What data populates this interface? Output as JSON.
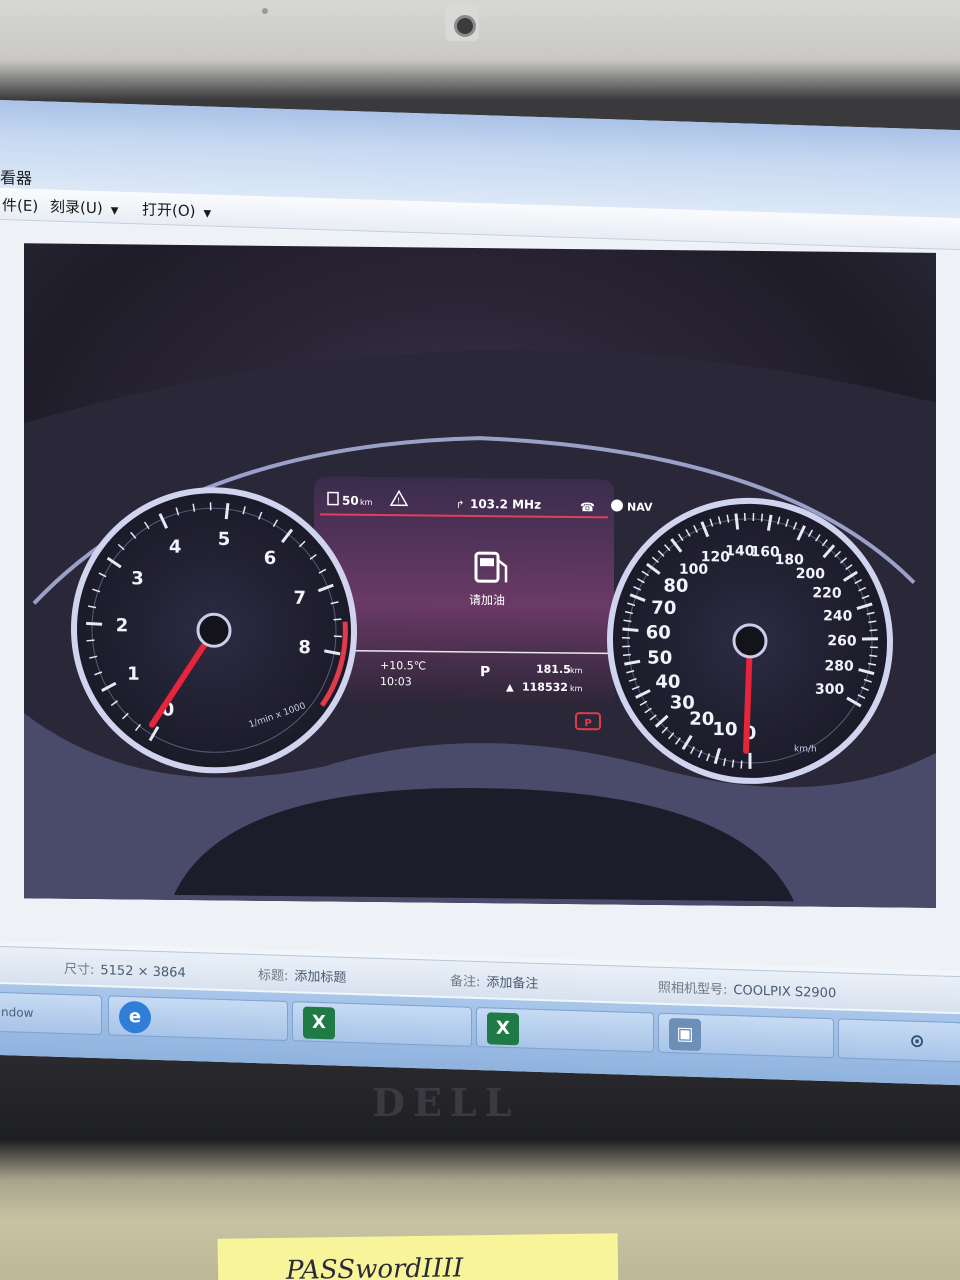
{
  "window": {
    "title": "看器",
    "menu": [
      {
        "label": "件(E)",
        "has_caret": false
      },
      {
        "label": "刻录(U)",
        "has_caret": true
      },
      {
        "label": "打开(O)",
        "has_caret": true
      }
    ]
  },
  "photo": {
    "cluster": {
      "top_bar": {
        "range": "50",
        "range_unit": "km",
        "radio": "103.2 MHz",
        "nav": "NAV"
      },
      "center_msg": "请加油",
      "bottom_info": {
        "outside_temp": "+10.5℃",
        "time": "10:03",
        "gear": "P",
        "trip": "181.5",
        "trip_unit": "km",
        "odometer": "118532",
        "odo_unit": "km"
      },
      "tacho": {
        "labels": [
          "0",
          "1",
          "2",
          "3",
          "4",
          "5",
          "6",
          "7",
          "8"
        ],
        "caption": "1/min x 1000"
      },
      "speedo": {
        "labels": [
          "0",
          "10",
          "20",
          "30",
          "40",
          "50",
          "60",
          "70",
          "80",
          "100",
          "120",
          "140",
          "160",
          "180",
          "200",
          "220",
          "240",
          "260",
          "280",
          "300"
        ],
        "unit": "km/h"
      }
    }
  },
  "status": {
    "size_label": "尺寸:",
    "size_value": "5152 × 3864",
    "title_label": "标题:",
    "title_value": "添加标题",
    "note_label": "备注:",
    "note_value": "添加备注",
    "camera_label": "照相机型号:",
    "camera_value": "COOLPIX S2900"
  },
  "taskbar": {
    "items": [
      {
        "label": "ndow",
        "icon": "none"
      },
      {
        "label": "",
        "icon": "edge-icon"
      },
      {
        "label": "",
        "icon": "excel-icon"
      },
      {
        "label": "",
        "icon": "excel-icon"
      },
      {
        "label": "",
        "icon": "photo-viewer-icon"
      }
    ]
  },
  "laptop": {
    "brand": "DELL",
    "sticky_note": "PASSwordIIII"
  },
  "colors": {
    "needle": "#e8243a",
    "gauge_ring": "#c9cde8",
    "redline": "#e23a4a",
    "screen_bg": "#2b2637"
  }
}
